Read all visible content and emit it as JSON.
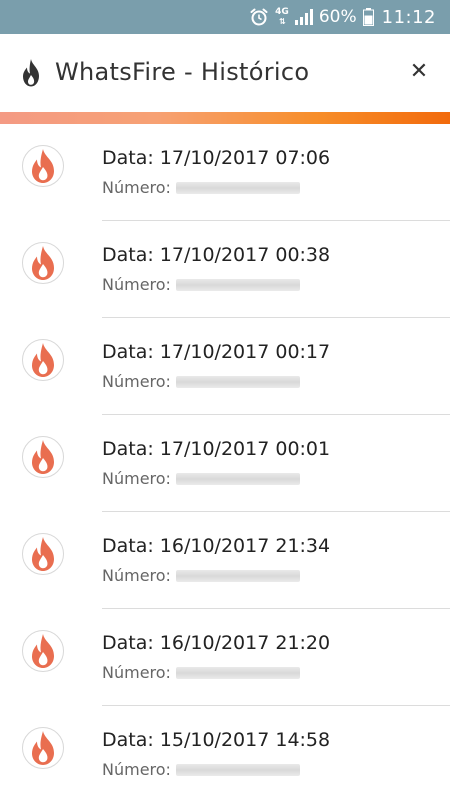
{
  "status_bar": {
    "network": "4G",
    "battery_percent": "60%",
    "time": "11:12",
    "icons": [
      "alarm-icon",
      "network-4g-icon",
      "signal-icon",
      "battery-icon"
    ]
  },
  "app_bar": {
    "title": "WhatsFire - Histórico",
    "close_glyph": "✕",
    "icons": [
      "flame-icon",
      "close-icon"
    ]
  },
  "colors": {
    "status_bar": "#7a9eac",
    "accent_start": "#f49a84",
    "accent_end": "#f26a0c",
    "flame": "#e96e50"
  },
  "history": [
    {
      "date_text": "Data: 17/10/2017 07:06",
      "number_label": "Número:"
    },
    {
      "date_text": "Data: 17/10/2017 00:38",
      "number_label": "Número:"
    },
    {
      "date_text": "Data: 17/10/2017 00:17",
      "number_label": "Número:"
    },
    {
      "date_text": "Data: 17/10/2017 00:01",
      "number_label": "Número:"
    },
    {
      "date_text": "Data: 16/10/2017 21:34",
      "number_label": "Número:"
    },
    {
      "date_text": "Data: 16/10/2017 21:20",
      "number_label": "Número:"
    },
    {
      "date_text": "Data: 15/10/2017 14:58",
      "number_label": "Número:"
    }
  ]
}
